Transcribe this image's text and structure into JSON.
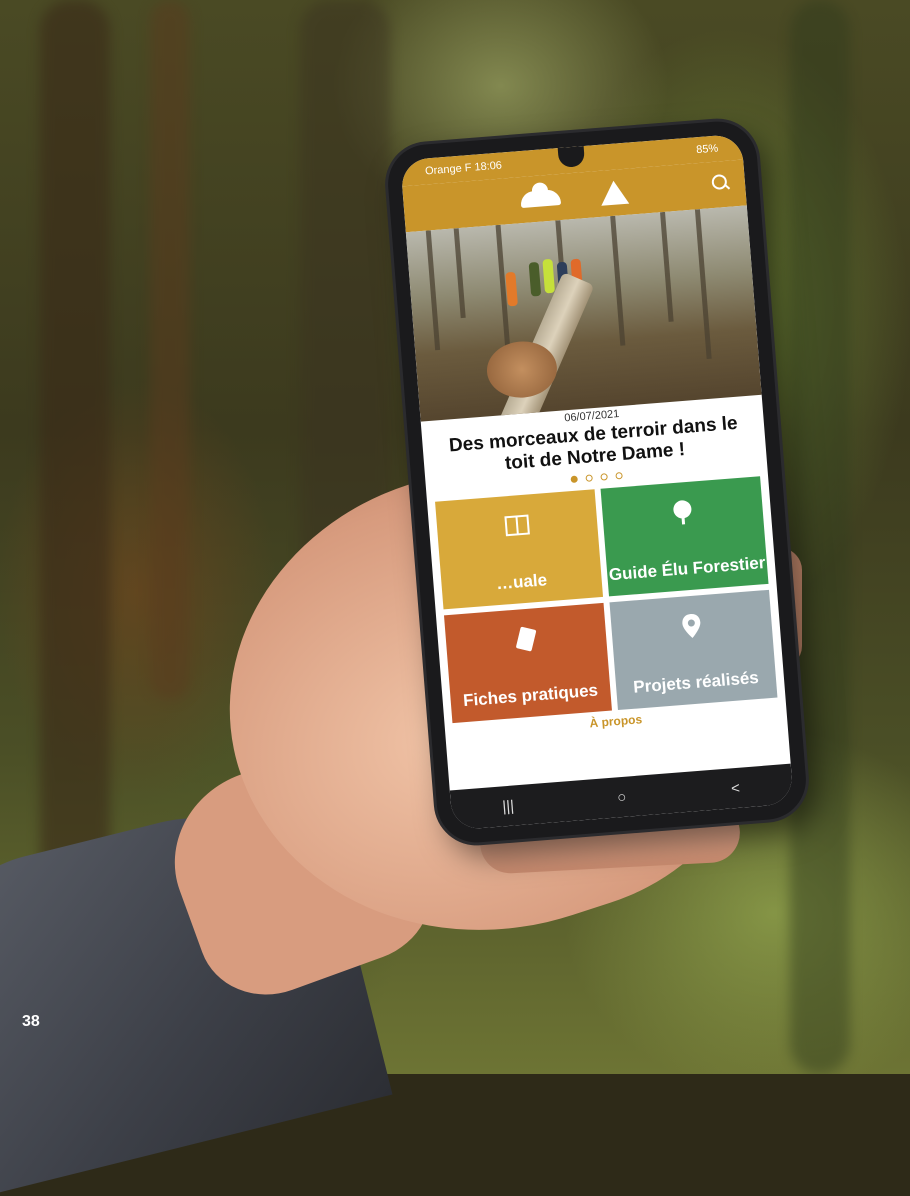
{
  "page_number": "38",
  "status_bar": {
    "left": "Orange F 18:06",
    "right": "85%"
  },
  "article": {
    "date": "06/07/2021",
    "headline": "Des morceaux de terroir dans le toit de Notre Dame !"
  },
  "carousel": {
    "count": 4,
    "active_index": 0
  },
  "tiles": [
    {
      "label": "…uale",
      "color": "#d8a93a",
      "icon": "book-icon"
    },
    {
      "label": "Guide Élu Forestier",
      "color": "#3a9a4f",
      "icon": "tree-icon"
    },
    {
      "label": "Fiches pratiques",
      "color": "#c25a2c",
      "icon": "document-icon"
    },
    {
      "label": "Projets réalisés",
      "color": "#9aa8ae",
      "icon": "location-pin-icon"
    }
  ],
  "footer_link": "À propos",
  "nav": {
    "recent": "|||",
    "home": "○",
    "back": "<"
  },
  "colors": {
    "brand": "#c9952a"
  }
}
